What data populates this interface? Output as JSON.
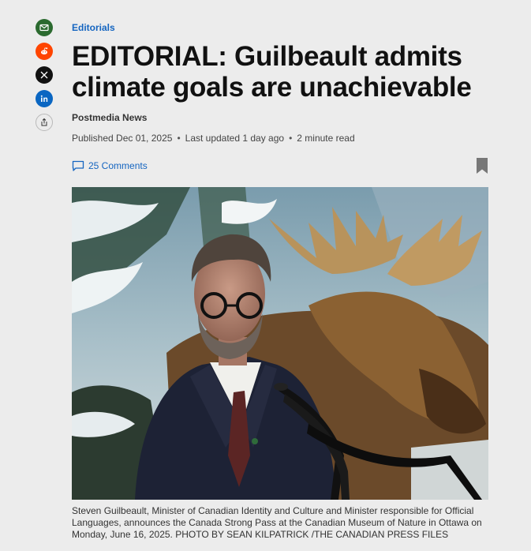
{
  "share": {
    "email_color": "#2b6a2f",
    "reddit_color": "#ff4500",
    "x_color": "#111111",
    "linkedin_color": "#0a66c2"
  },
  "article": {
    "section": "Editorials",
    "headline": "EDITORIAL: Guilbeault admits climate goals are unachievable",
    "byline": "Postmedia News",
    "published": "Published Dec 01, 2025",
    "updated": "Last updated 1 day ago",
    "read_time": "2 minute read",
    "comments": "25 Comments",
    "caption": "Steven Guilbeault, Minister of Canadian Identity and Culture and Minister responsible for Official Languages, announces the Canada Strong Pass at the Canadian Museum of Nature in Ottawa on Monday, June 16, 2025. PHOTO BY SEAN KILPATRICK /THE CANADIAN PRESS FILES"
  },
  "colors": {
    "link": "#1565c0",
    "background": "#ececec"
  }
}
